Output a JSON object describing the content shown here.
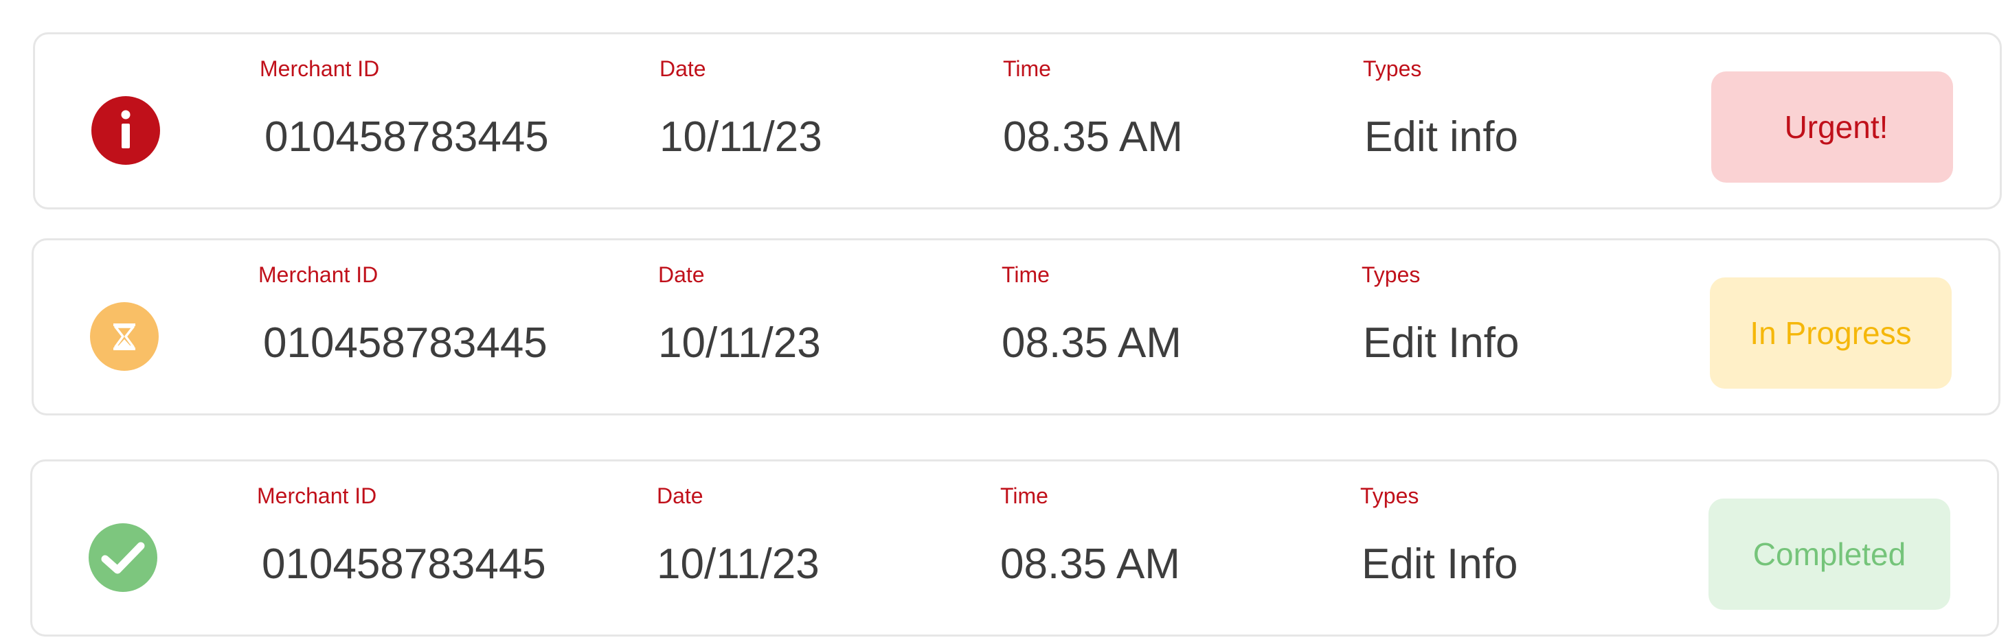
{
  "colors": {
    "label": "#c0101a",
    "value": "#3d3d3d",
    "urgent_bg": "#fad2d3",
    "urgent_fg": "#c0101a",
    "progress_bg": "#fff0c8",
    "progress_fg": "#f5b70a",
    "progress_icon": "#f9bf66",
    "complete_bg": "#e2f4e3",
    "complete_fg": "#75c47a",
    "complete_icon": "#7dc67e"
  },
  "labels": {
    "merchant_id": "Merchant ID",
    "date": "Date",
    "time": "Time",
    "types": "Types"
  },
  "rows": [
    {
      "icon": "urgent-info-icon",
      "merchant_id": "010458783445",
      "date": "10/11/23",
      "time": "08.35 AM",
      "type": "Edit info",
      "status": "Urgent!"
    },
    {
      "icon": "hourglass-icon",
      "merchant_id": "010458783445",
      "date": "10/11/23",
      "time": "08.35 AM",
      "type": "Edit Info",
      "status": "In Progress"
    },
    {
      "icon": "checkmark-icon",
      "merchant_id": "010458783445",
      "date": "10/11/23",
      "time": "08.35 AM",
      "type": "Edit Info",
      "status": "Completed"
    }
  ]
}
